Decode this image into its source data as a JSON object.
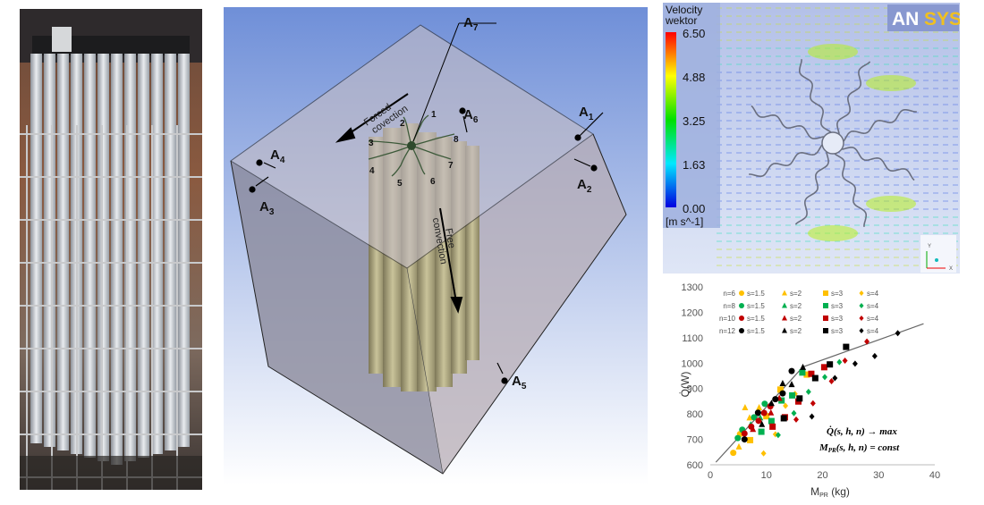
{
  "diagram": {
    "labels": {
      "a1": "A",
      "a1_sub": "1",
      "a2": "A",
      "a2_sub": "2",
      "a3": "A",
      "a3_sub": "3",
      "a4": "A",
      "a4_sub": "4",
      "a5": "A",
      "a5_sub": "5",
      "a6": "A",
      "a6_sub": "6",
      "a7": "A",
      "a7_sub": "7"
    },
    "forced_line1": "Forced",
    "forced_line2": "covection",
    "free_line1": "Free",
    "free_line2": "convection",
    "fin_numbers": [
      "1",
      "2",
      "3",
      "4",
      "5",
      "6",
      "7",
      "8"
    ]
  },
  "cfd": {
    "legend_title_1": "Velocity",
    "legend_title_2": "wektor",
    "ticks": [
      "6.50",
      "4.88",
      "3.25",
      "1.63",
      "0.00"
    ],
    "unit": "[m s^-1]",
    "logo_an": "AN",
    "logo_sys": "SYS",
    "axis_y": "Y",
    "axis_x": "X"
  },
  "chart_data": {
    "type": "scatter",
    "xlabel": "M",
    "xlabel_sub": "PR",
    "xlabel_unit": " (kg)",
    "ylabel": "Q̇(W)",
    "xlim": [
      0,
      40
    ],
    "ylim": [
      600,
      1300
    ],
    "xticks": [
      "0",
      "10",
      "20",
      "30",
      "40"
    ],
    "yticks": [
      "600",
      "700",
      "800",
      "900",
      "1000",
      "1100",
      "1200",
      "1300"
    ],
    "grid": false,
    "legend_placement": "top-left",
    "annotation_1": "Q̇(s, h, n) → max",
    "annotation_2": "M",
    "annotation_2_sub": "PR",
    "annotation_2_rest": "(s, h, n) = const",
    "trend_line": [
      [
        1,
        610
      ],
      [
        16.5,
        985
      ],
      [
        38,
        1155
      ]
    ],
    "groups": [
      {
        "n_label": "n=6",
        "color": "#FFC000"
      },
      {
        "n_label": "n=8",
        "color": "#00B050"
      },
      {
        "n_label": "n=10",
        "color": "#C00000"
      },
      {
        "n_label": "n=12",
        "color": "#000000"
      }
    ],
    "series": [
      {
        "name": "n=6 s=1.5",
        "group": 0,
        "marker": "circle",
        "label": "s=1.5",
        "points": [
          [
            4.1,
            647
          ],
          [
            5.3,
            721
          ]
        ]
      },
      {
        "name": "n=6 s=2",
        "group": 0,
        "marker": "triangle",
        "label": "s=2",
        "points": [
          [
            5.1,
            671
          ],
          [
            6.2,
            825
          ],
          [
            8.7,
            825
          ],
          [
            7.0,
            785
          ]
        ]
      },
      {
        "name": "n=6 s=3",
        "group": 0,
        "marker": "square",
        "label": "s=3",
        "points": [
          [
            7.1,
            697
          ],
          [
            12.5,
            896
          ],
          [
            17.2,
            955
          ],
          [
            10.0,
            791
          ]
        ]
      },
      {
        "name": "n=6 s=4",
        "group": 0,
        "marker": "diamond",
        "label": "s=4",
        "points": [
          [
            9.5,
            645
          ],
          [
            11.6,
            720
          ],
          [
            13.4,
            832
          ],
          [
            15.1,
            879
          ]
        ]
      },
      {
        "name": "n=8 s=1.5",
        "group": 1,
        "marker": "circle",
        "label": "s=1.5",
        "points": [
          [
            4.9,
            705
          ],
          [
            7.8,
            787
          ],
          [
            9.7,
            840
          ],
          [
            5.7,
            738
          ]
        ]
      },
      {
        "name": "n=8 s=2",
        "group": 1,
        "marker": "triangle",
        "label": "s=2",
        "points": [
          [
            7.2,
            758
          ],
          [
            8.9,
            785
          ]
        ]
      },
      {
        "name": "n=8 s=3",
        "group": 1,
        "marker": "square",
        "label": "s=3",
        "points": [
          [
            9.1,
            730
          ],
          [
            10.9,
            772
          ],
          [
            12.7,
            853
          ],
          [
            14.6,
            873
          ],
          [
            16.4,
            963
          ]
        ]
      },
      {
        "name": "n=8 s=4",
        "group": 1,
        "marker": "diamond",
        "label": "s=4",
        "points": [
          [
            12.1,
            717
          ],
          [
            14.9,
            803
          ],
          [
            17.5,
            887
          ],
          [
            20.4,
            945
          ],
          [
            23.0,
            1004
          ]
        ]
      },
      {
        "name": "n=10 s=1.5",
        "group": 2,
        "marker": "circle",
        "label": "s=1.5",
        "points": [
          [
            6.1,
            723
          ],
          [
            7.3,
            750
          ],
          [
            8.6,
            773
          ],
          [
            9.6,
            804
          ],
          [
            10.7,
            830
          ]
        ]
      },
      {
        "name": "n=10 s=2",
        "group": 2,
        "marker": "triangle",
        "label": "s=2",
        "points": [
          [
            7.6,
            740
          ],
          [
            10.8,
            805
          ],
          [
            12.3,
            862
          ]
        ]
      },
      {
        "name": "n=10 s=3",
        "group": 2,
        "marker": "square",
        "label": "s=3",
        "points": [
          [
            11.1,
            750
          ],
          [
            13.3,
            787
          ],
          [
            15.7,
            849
          ],
          [
            18.0,
            958
          ],
          [
            20.3,
            984
          ]
        ]
      },
      {
        "name": "n=10 s=4",
        "group": 2,
        "marker": "diamond",
        "label": "s=4",
        "points": [
          [
            15.3,
            778
          ],
          [
            18.3,
            842
          ],
          [
            21.6,
            929
          ],
          [
            24.0,
            1010
          ],
          [
            27.9,
            1085
          ]
        ]
      },
      {
        "name": "n=12 s=1.5",
        "group": 3,
        "marker": "circle",
        "label": "s=1.5",
        "points": [
          [
            6.1,
            700
          ],
          [
            8.5,
            805
          ],
          [
            11.6,
            858
          ],
          [
            12.9,
            881
          ],
          [
            14.5,
            969
          ]
        ]
      },
      {
        "name": "n=12 s=2",
        "group": 3,
        "marker": "triangle",
        "label": "s=2",
        "points": [
          [
            9.2,
            759
          ],
          [
            10.9,
            842
          ],
          [
            12.9,
            920
          ],
          [
            14.5,
            916
          ],
          [
            16.5,
            984
          ]
        ]
      },
      {
        "name": "n=12 s=3",
        "group": 3,
        "marker": "square",
        "label": "s=3",
        "points": [
          [
            13.1,
            783
          ],
          [
            15.9,
            861
          ],
          [
            18.7,
            941
          ],
          [
            21.3,
            995
          ],
          [
            24.2,
            1064
          ]
        ]
      },
      {
        "name": "n=12 s=4",
        "group": 3,
        "marker": "diamond",
        "label": "s=4",
        "points": [
          [
            18.1,
            790
          ],
          [
            22.2,
            941
          ],
          [
            25.8,
            998
          ],
          [
            29.3,
            1028
          ],
          [
            33.4,
            1118
          ]
        ]
      }
    ]
  }
}
